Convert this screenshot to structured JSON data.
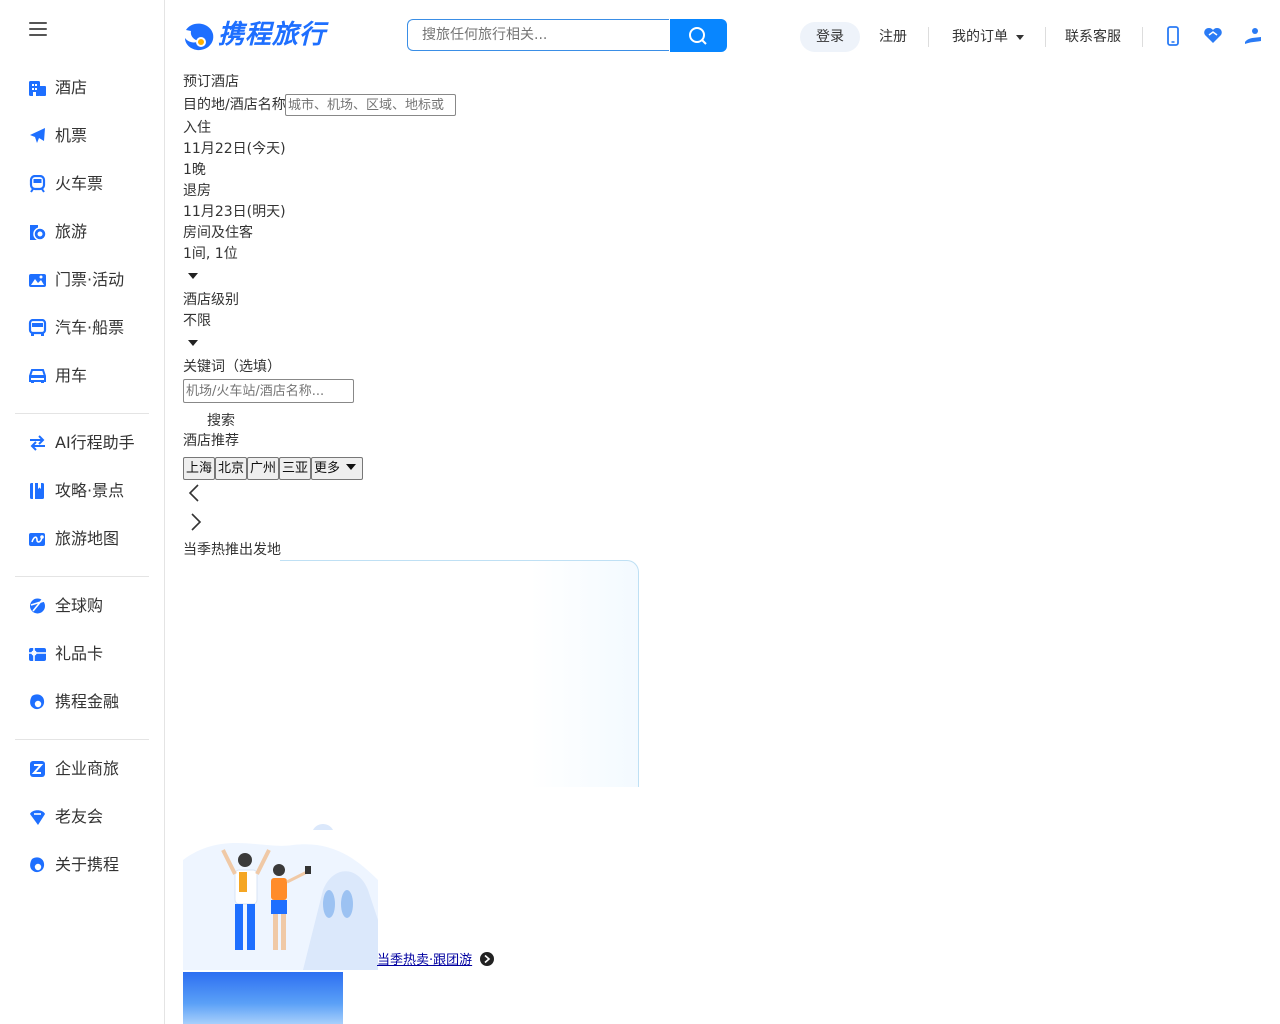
{
  "header": {
    "brand": "携程旅行",
    "search_placeholder": "搜旅任何旅行相关...",
    "login": "登录",
    "register": "注册",
    "my_orders": "我的订单",
    "customer_service": "联系客服",
    "brand_color": "#1e6fff",
    "accent_color": "#0886ff"
  },
  "sidebar": {
    "menu_icon": "hamburger-icon",
    "groups": [
      [
        {
          "label": "酒店",
          "icon": "hotel-icon"
        },
        {
          "label": "机票",
          "icon": "plane-icon"
        },
        {
          "label": "火车票",
          "icon": "train-icon"
        },
        {
          "label": "旅游",
          "icon": "tour-icon"
        },
        {
          "label": "门票·活动",
          "icon": "ticket-icon"
        },
        {
          "label": "汽车·船票",
          "icon": "bus-icon"
        },
        {
          "label": "用车",
          "icon": "car-icon"
        }
      ],
      [
        {
          "label": "AI行程助手",
          "icon": "ai-assistant-icon"
        },
        {
          "label": "攻略·景点",
          "icon": "guide-icon"
        },
        {
          "label": "旅游地图",
          "icon": "map-icon"
        }
      ],
      [
        {
          "label": "全球购",
          "icon": "global-shop-icon"
        },
        {
          "label": "礼品卡",
          "icon": "gift-card-icon"
        },
        {
          "label": "携程金融",
          "icon": "finance-icon"
        }
      ],
      [
        {
          "label": "企业商旅",
          "icon": "business-icon"
        },
        {
          "label": "老友会",
          "icon": "club-icon"
        },
        {
          "label": "关于携程",
          "icon": "about-icon"
        }
      ]
    ]
  },
  "booking": {
    "title": "预订酒店",
    "destination_label": "目的地/酒店名称",
    "destination_placeholder": "城市、机场、区域、地标或",
    "checkin_label": "入住",
    "checkin_date": "11月22日(今天)",
    "nights": "1晚",
    "checkout_label": "退房",
    "checkout_date": "11月23日(明天)",
    "rooms_label": "房间及住客",
    "rooms_value": "1间, 1位",
    "star_label": "酒店级别",
    "star_value": "不限",
    "keyword_label": "关键词（选填）",
    "keyword_placeholder": "机场/火车站/酒店名称...",
    "search_button": "搜索"
  },
  "recommend": {
    "title": "酒店推荐",
    "cities": [
      "上海",
      "北京",
      "广州",
      "三亚"
    ],
    "more": "更多"
  },
  "season": {
    "title": "当季热推出发地",
    "promo_link": "当季热卖·跟团游"
  }
}
